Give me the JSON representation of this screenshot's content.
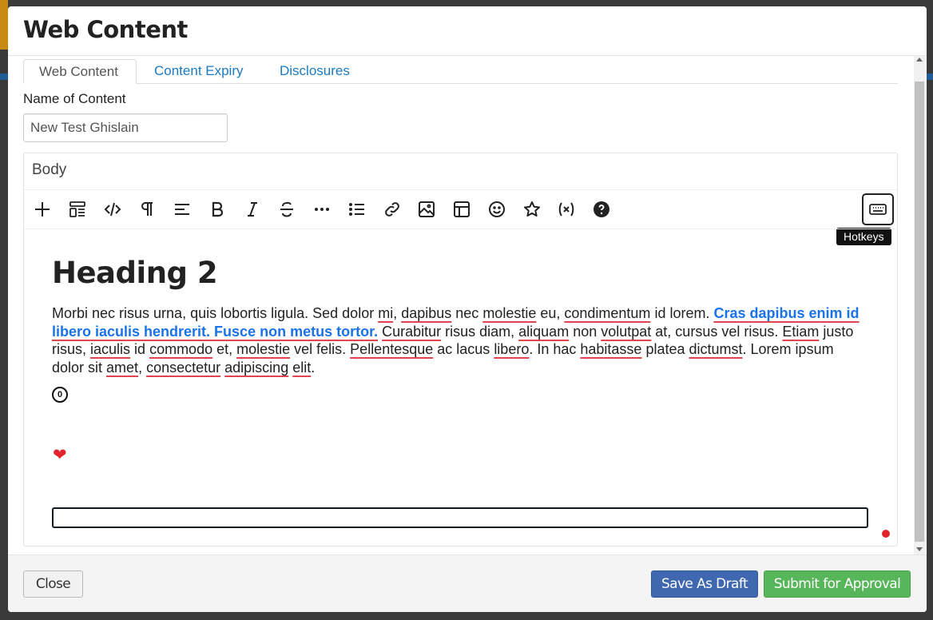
{
  "modal": {
    "title": "Web Content"
  },
  "tabs": [
    {
      "label": "Web Content",
      "active": true
    },
    {
      "label": "Content Expiry",
      "active": false
    },
    {
      "label": "Disclosures",
      "active": false
    }
  ],
  "name_field": {
    "label": "Name of Content",
    "value": "New Test Ghislain"
  },
  "editor": {
    "title": "Body",
    "toolbar": [
      "plus-icon",
      "template-icon",
      "code-icon",
      "pilcrow-icon",
      "align-left-icon",
      "bold-icon",
      "italic-icon",
      "strikethrough-icon",
      "more-icon",
      "list-icon",
      "link-icon",
      "image-icon",
      "table-icon",
      "emoji-icon",
      "star-icon",
      "variable-icon",
      "help-icon",
      "keyboard-icon"
    ],
    "hotkeys_tooltip": "Hotkeys",
    "heading": "Heading 2",
    "paragraph": {
      "p1": "Morbi nec risus urna, quis lobortis ligula. Sed dolor ",
      "w_mi": "mi",
      "p2": ", ",
      "w_dapibus": "dapibus",
      "p3": " nec ",
      "w_molestie": "molestie",
      "p4": " eu, ",
      "w_condimentum": "condimentum",
      "p5": " id lorem. ",
      "link_text": "Cras dapibus enim id libero iaculis hendrerit. Fusce non metus tortor.",
      "p6": " ",
      "w_curabitur": "Curabitur",
      "p7": " risus diam, ",
      "w_aliquam": "aliquam",
      "p8": " non ",
      "w_volutpat": "volutpat",
      "p9": " at, cursus vel risus. ",
      "w_etiam": "Etiam",
      "p10": " justo risus, ",
      "w_iaculis": "iaculis",
      "p11": " id ",
      "w_commodo": "commodo",
      "p12": " et, ",
      "w_molestie2": "molestie",
      "p13": " vel felis. ",
      "w_pellentesque": "Pellentesque",
      "p14": " ac lacus ",
      "w_libero": "libero",
      "p15": ". In hac ",
      "w_habitasse": "habitasse",
      "p16": " platea ",
      "w_dictumst": "dictumst",
      "p17": ". Lorem ipsum dolor sit ",
      "w_amet": "amet",
      "p18": ", ",
      "w_consectetur": "consectetur",
      "p19": " ",
      "w_adipiscing": "adipiscing",
      "p20": " ",
      "w_elit": "elit",
      "p21": "."
    },
    "circled_char": "0",
    "heart_glyph": "❤"
  },
  "footer": {
    "close_label": "Close",
    "draft_label": "Save As Draft",
    "submit_label": "Submit for Approval"
  },
  "colors": {
    "link": "#1a73e8",
    "draft": "#3f68b0",
    "submit": "#58b65a",
    "spellcheck": "#e0444c"
  }
}
